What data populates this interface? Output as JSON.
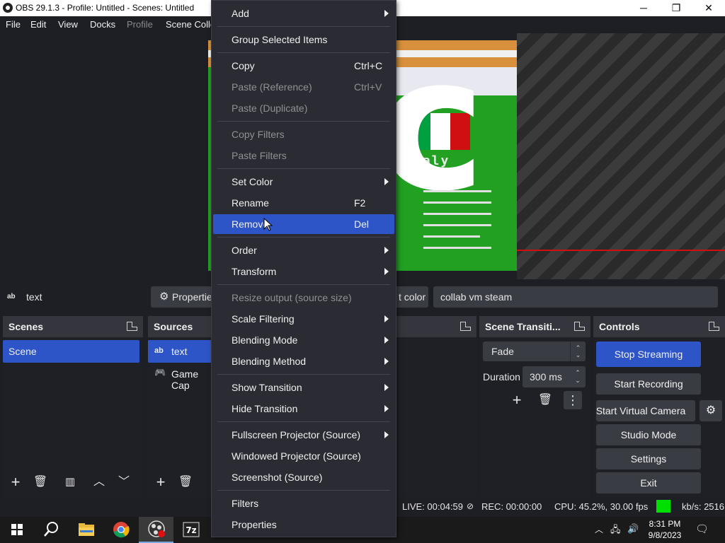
{
  "window": {
    "title": "OBS 29.1.3 - Profile: Untitled - Scenes: Untitled",
    "minimize": "─",
    "maximize": "❐",
    "close": "✕"
  },
  "menubar": {
    "file": "File",
    "edit": "Edit",
    "view": "View",
    "docks": "Docks",
    "profile": "Profile",
    "scene_collection": "Scene Colle"
  },
  "preview": {
    "game_text": "taly",
    "flag_colors": [
      "#00a040",
      "#ffffff",
      "#d01010"
    ]
  },
  "context_bar": {
    "source_icon": "ab",
    "source_name": "text",
    "properties_label": "Properties",
    "color_label": "t color",
    "text_value": "collab vm steam"
  },
  "scenes_dock": {
    "title": "Scenes",
    "items": [
      "Scene"
    ],
    "selected": "Scene"
  },
  "sources_dock": {
    "title": "Sources",
    "items": [
      {
        "icon": "ab",
        "label": "text"
      },
      {
        "icon": "gamepad-icon",
        "label": "Game Cap"
      }
    ]
  },
  "transitions_dock": {
    "title": "Scene Transiti...",
    "transition": "Fade",
    "duration_label": "Duration",
    "duration_value": "300 ms"
  },
  "controls_dock": {
    "title": "Controls",
    "stop_streaming": "Stop Streaming",
    "start_recording": "Start Recording",
    "start_virtual_camera": "Start Virtual Camera",
    "studio_mode": "Studio Mode",
    "settings": "Settings",
    "exit": "Exit"
  },
  "status_bar": {
    "live": "LIVE: 00:04:59",
    "rec": "REC: 00:00:00",
    "cpu": "CPU: 45.2%, 30.00 fps",
    "kbs": "kb/s: 2516",
    "indicator_color": "#00e000"
  },
  "context_menu": {
    "items": [
      {
        "label": "Add",
        "submenu": true
      },
      {
        "label": "Group Selected Items"
      },
      {
        "label": "Copy",
        "shortcut": "Ctrl+C"
      },
      {
        "label": "Paste (Reference)",
        "shortcut": "Ctrl+V",
        "disabled": true
      },
      {
        "label": "Paste (Duplicate)",
        "disabled": true
      },
      {
        "label": "Copy Filters",
        "disabled": true
      },
      {
        "label": "Paste Filters",
        "disabled": true
      },
      {
        "label": "Set Color",
        "submenu": true
      },
      {
        "label": "Rename",
        "shortcut": "F2"
      },
      {
        "label": "Remove",
        "shortcut": "Del",
        "highlighted": true
      },
      {
        "label": "Order",
        "submenu": true
      },
      {
        "label": "Transform",
        "submenu": true
      },
      {
        "label": "Resize output (source size)",
        "disabled": true
      },
      {
        "label": "Scale Filtering",
        "submenu": true
      },
      {
        "label": "Blending Mode",
        "submenu": true
      },
      {
        "label": "Blending Method",
        "submenu": true
      },
      {
        "label": "Show Transition",
        "submenu": true
      },
      {
        "label": "Hide Transition",
        "submenu": true
      },
      {
        "label": "Fullscreen Projector (Source)",
        "submenu": true
      },
      {
        "label": "Windowed Projector (Source)"
      },
      {
        "label": "Screenshot (Source)"
      },
      {
        "label": "Filters"
      },
      {
        "label": "Properties"
      }
    ]
  },
  "taskbar": {
    "time": "8:31 PM",
    "date": "9/8/2023",
    "apps": [
      "start-icon",
      "search-icon",
      "file-explorer-icon",
      "chrome-icon",
      "obs-icon",
      "7zip-icon"
    ]
  }
}
